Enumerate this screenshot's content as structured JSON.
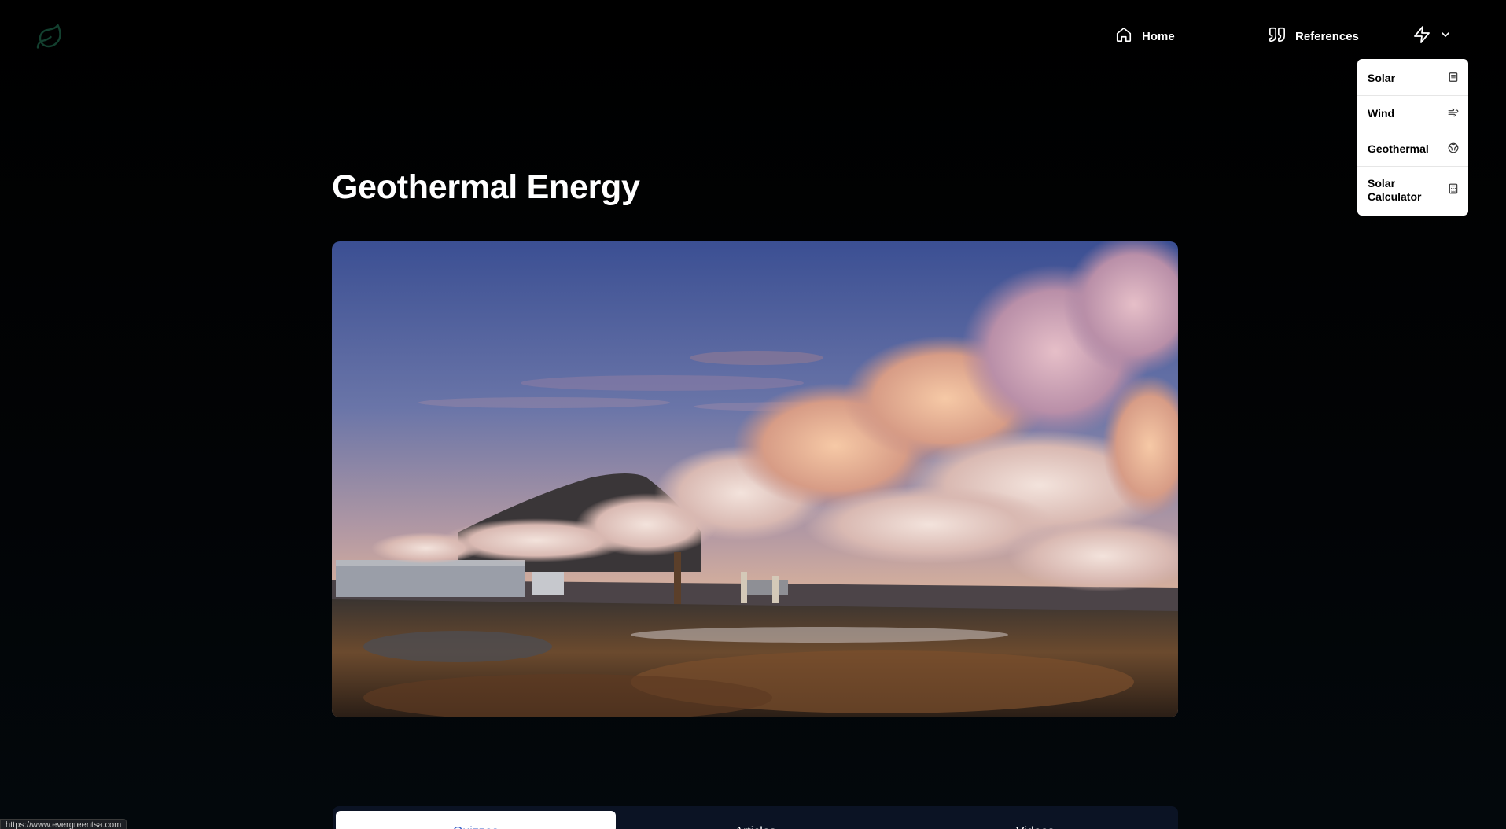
{
  "header": {
    "logo_icon": "leaf-icon",
    "nav": [
      {
        "label": "Home",
        "icon": "home-icon"
      },
      {
        "label": "References",
        "icon": "quote-icon"
      }
    ],
    "energy_menu_icon": "bolt-icon",
    "energy_menu_caret": "chevron-down-icon"
  },
  "dropdown": {
    "items": [
      {
        "label": "Solar",
        "icon": "solar-panel-icon"
      },
      {
        "label": "Wind",
        "icon": "wind-icon"
      },
      {
        "label": "Geothermal",
        "icon": "globe-icon"
      },
      {
        "label": "Solar Calculator",
        "icon": "calculator-icon"
      }
    ]
  },
  "main": {
    "title": "Geothermal Energy",
    "hero_image": "geothermal-plant-photo",
    "tabs": [
      {
        "label": "Quizzes",
        "active": true
      },
      {
        "label": "Articles",
        "active": false
      },
      {
        "label": "Videos",
        "active": false
      }
    ]
  },
  "statusbar": {
    "url": "https://www.evergreentsa.com"
  },
  "colors": {
    "logo_green": "#0f3a2a",
    "tab_bar": "#0b1324",
    "active_tab_text": "#3d63c9"
  }
}
